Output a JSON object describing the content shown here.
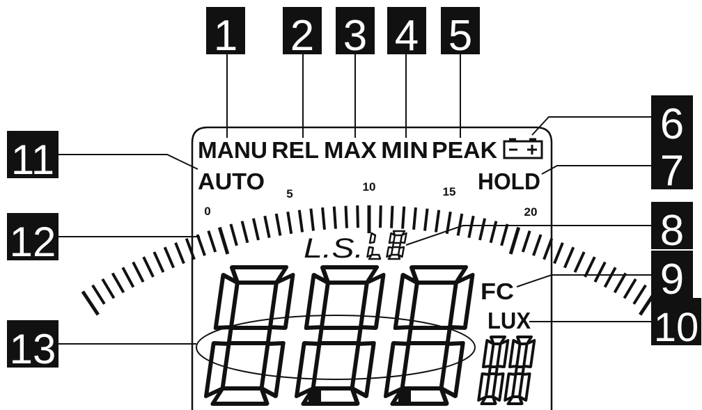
{
  "callouts": [
    "1",
    "2",
    "3",
    "4",
    "5",
    "6",
    "7",
    "8",
    "9",
    "10",
    "11",
    "12",
    "13"
  ],
  "indicators": {
    "manu": "MANU",
    "rel": "REL",
    "max": "MAX",
    "min": "MIN",
    "peak": "PEAK",
    "auto": "AUTO",
    "hold": "HOLD",
    "fc": "FC",
    "lux": "LUX",
    "ls_prefix": "L.S.",
    "battery_icon": "battery-icon"
  },
  "bargraph": {
    "scale_labels": [
      "0",
      "5",
      "10",
      "15",
      "20"
    ]
  },
  "colors": {
    "callout_bg": "#111111",
    "callout_fg": "#ffffff",
    "segment": "#111111"
  }
}
